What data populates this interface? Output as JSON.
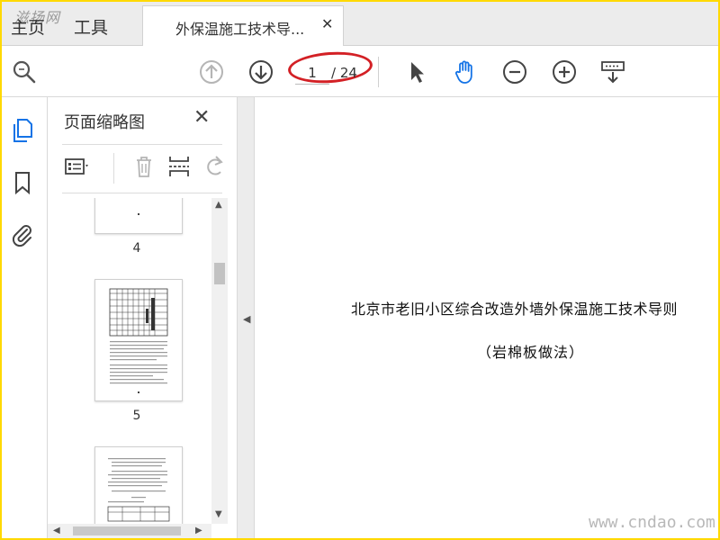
{
  "watermark_top": "滋扬网",
  "watermark_bottom": "www.cndao.com",
  "nav": {
    "home_label": "主页",
    "tools_label": "工具"
  },
  "document_tab": {
    "title": "外保温施工技术导..."
  },
  "toolbar": {
    "current_page": "1",
    "total_pages": "/ 24",
    "annotation_color": "#d32025",
    "icons": [
      "search-icon",
      "page-up-icon",
      "page-down-icon",
      "select-arrow-icon",
      "hand-tool-icon",
      "zoom-out-icon",
      "zoom-in-icon",
      "read-mode-icon"
    ]
  },
  "left_rail": {
    "icons": [
      "page-thumbnails-icon",
      "bookmark-icon",
      "attachment-icon"
    ],
    "accent": "#1473e6"
  },
  "thumbnail_panel": {
    "title": "页面缩略图",
    "close_symbol": "✕",
    "tools": [
      "thumbnail-options-icon",
      "delete-page-icon",
      "insert-page-icon",
      "rotate-page-icon"
    ],
    "pages": [
      {
        "number": "4"
      },
      {
        "number": "5"
      }
    ]
  },
  "document": {
    "title": "北京市老旧小区综合改造外墙外保温施工技术导则",
    "subtitle": "（岩棉板做法）"
  }
}
